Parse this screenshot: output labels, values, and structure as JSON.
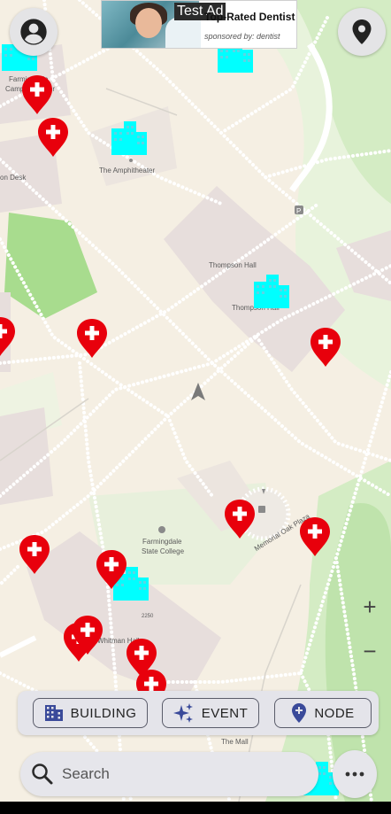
{
  "colors": {
    "map_background": "#f5efe3",
    "path_dots": "#ffffff",
    "grass": "#d4ecc4",
    "grass_dark": "#a8dc8e",
    "building_fill": "#e7dedc",
    "health_marker": "#e8000c",
    "building_marker": "#00ffff",
    "chip_border": "#5a5c6a",
    "chip_icon": "#3a4a9a"
  },
  "map": {
    "labels": {
      "campus_center_1": "Farmingdale",
      "campus_center_2": "Campus Center",
      "amphitheater": "The Amphitheater",
      "desk": "on Desk",
      "thompson_1": "Thompson Hall",
      "thompson_2": "Thompson Hall",
      "college_1": "Farmingdale",
      "college_2": "State College",
      "whitman": "Whitman Hall",
      "plaza": "Memorial Oak Plaza",
      "mall": "The Mall",
      "building_number": "2250",
      "parking": "P"
    }
  },
  "ad": {
    "tag": "Test Ad",
    "title": "Top-Rated Dentist",
    "sponsor": "sponsored by: dentist"
  },
  "controls": {
    "zoom_in": "+",
    "zoom_out": "−"
  },
  "filters": [
    {
      "label": "BUILDING",
      "icon": "building-icon"
    },
    {
      "label": "EVENT",
      "icon": "sparkle-icon"
    },
    {
      "label": "NODE",
      "icon": "location-pin-icon"
    }
  ],
  "search": {
    "placeholder": "Search"
  },
  "icons": {
    "profile": "account-circle-icon",
    "location": "location-pin-icon",
    "navigation": "navigation-arrow-icon",
    "more": "more-horizontal-icon"
  }
}
